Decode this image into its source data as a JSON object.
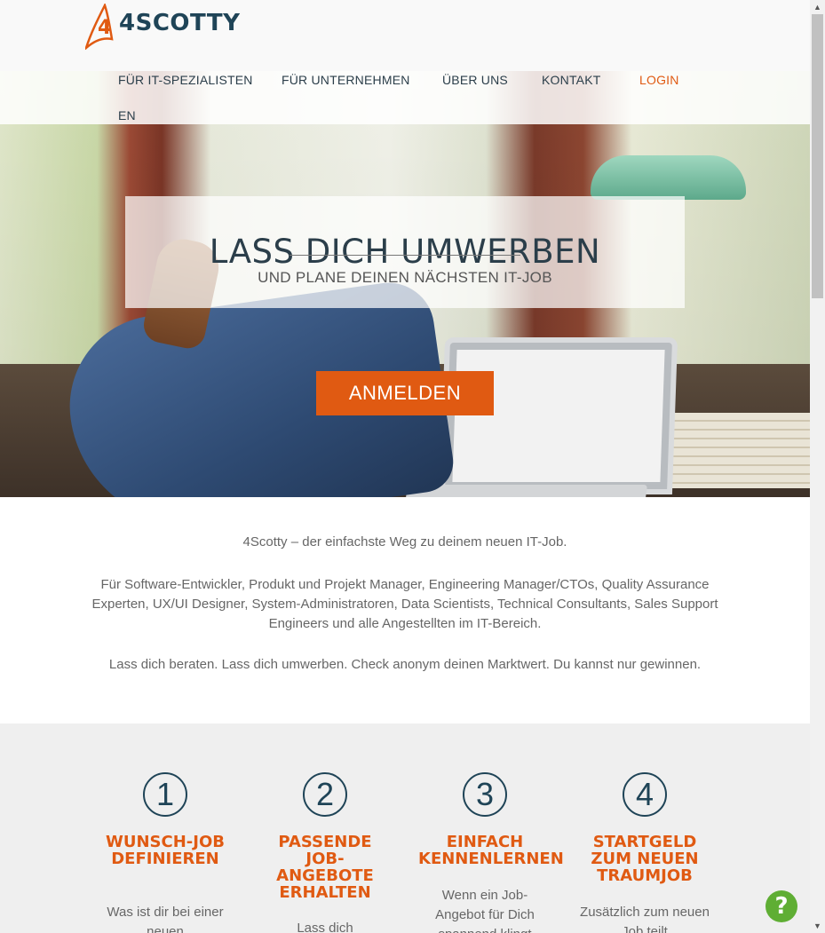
{
  "brand": {
    "name": "4SCOTTY",
    "logo_color": "#e05a12",
    "text_color": "#1f4457"
  },
  "nav": {
    "items": [
      {
        "label": "FÜR IT-SPEZIALISTEN"
      },
      {
        "label": "FÜR UNTERNEHMEN"
      },
      {
        "label": "ÜBER UNS"
      },
      {
        "label": "KONTAKT"
      },
      {
        "label": "LOGIN"
      },
      {
        "label": "EN"
      }
    ]
  },
  "hero": {
    "title": "LASS DICH UMWERBEN",
    "subtitle": "UND PLANE DEINEN NÄCHSTEN IT-JOB",
    "cta_label": "ANMELDEN",
    "accent": "#e05a12"
  },
  "intro": {
    "line1": "4Scotty – der einfachste Weg zu deinem neuen IT-Job.",
    "line2": "Für Software-Entwickler, Produkt und Projekt Manager, Engineering Manager/CTOs, Quality Assurance Experten, UX/UI Designer, System-Administratoren, Data Scientists, Technical Consultants, Sales Support Engineers und alle Angestellten im IT-Bereich.",
    "line3": "Lass dich beraten. Lass dich umwerben. Check anonym deinen Marktwert. Du kannst nur gewinnen."
  },
  "steps": [
    {
      "number": "1",
      "title": "WUNSCH-JOB DEFINIEREN",
      "text": "Was ist dir bei einer neuen"
    },
    {
      "number": "2",
      "title": "PASSENDE JOB-ANGEBOTE ERHALTEN",
      "text": "Lass dich"
    },
    {
      "number": "3",
      "title": "EINFACH KENNENLERNEN",
      "text": "Wenn ein Job-Angebot für Dich spannend klingt"
    },
    {
      "number": "4",
      "title": "STARTGELD ZUM NEUEN TRAUMJOB",
      "text": "Zusätzlich zum neuen Job teilt"
    }
  ],
  "help": {
    "icon": "question-mark-icon",
    "glyph": "?",
    "color": "#5fae34"
  }
}
